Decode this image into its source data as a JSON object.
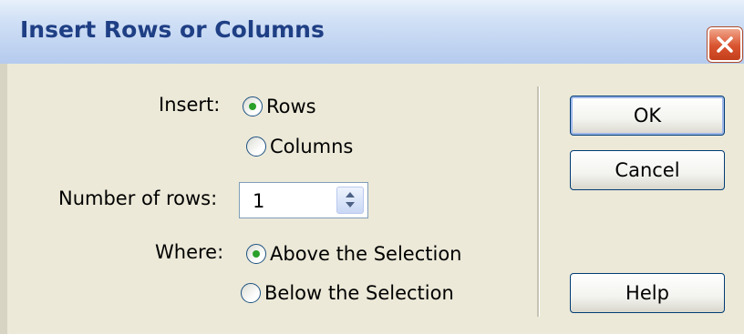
{
  "dialog": {
    "title": "Insert Rows or Columns",
    "close_icon": "close-x-icon"
  },
  "insert": {
    "label": "Insert:",
    "options": [
      "Rows",
      "Columns"
    ],
    "selected": "Rows"
  },
  "number": {
    "label": "Number of rows:",
    "value": "1"
  },
  "where": {
    "label": "Where:",
    "options": [
      "Above the Selection",
      "Below the Selection"
    ],
    "selected": "Above the Selection"
  },
  "buttons": {
    "ok": "OK",
    "cancel": "Cancel",
    "help": "Help"
  },
  "colors": {
    "title_text": "#1f3f85",
    "close_red": "#d9532f",
    "radio_dot": "#2aa02a",
    "dialog_bg": "#ece9d8"
  }
}
